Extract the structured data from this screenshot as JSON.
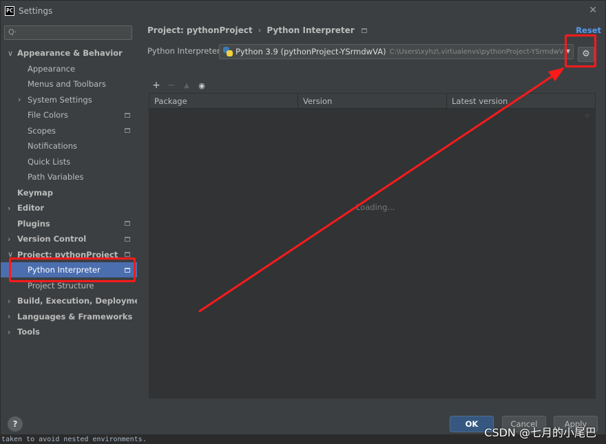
{
  "window": {
    "title": "Settings",
    "close_glyph": "✕",
    "logo_text": "PC"
  },
  "sidebar": {
    "search_placeholder": "",
    "items": [
      {
        "label": "Appearance & Behavior",
        "expanded": true,
        "bold": true
      },
      {
        "label": "Appearance"
      },
      {
        "label": "Menus and Toolbars"
      },
      {
        "label": "System Settings",
        "collapsed": true
      },
      {
        "label": "File Colors"
      },
      {
        "label": "Scopes"
      },
      {
        "label": "Notifications"
      },
      {
        "label": "Quick Lists"
      },
      {
        "label": "Path Variables"
      },
      {
        "label": "Keymap",
        "bold": true
      },
      {
        "label": "Editor",
        "bold": true,
        "collapsed": true
      },
      {
        "label": "Plugins",
        "bold": true
      },
      {
        "label": "Version Control",
        "bold": true,
        "collapsed": true
      },
      {
        "label": "Project: pythonProject",
        "bold": true,
        "expanded": true
      },
      {
        "label": "Python Interpreter",
        "selected": true
      },
      {
        "label": "Project Structure"
      },
      {
        "label": "Build, Execution, Deployment",
        "bold": true,
        "collapsed": true
      },
      {
        "label": "Languages & Frameworks",
        "bold": true,
        "collapsed": true
      },
      {
        "label": "Tools",
        "bold": true,
        "collapsed": true
      }
    ]
  },
  "main": {
    "breadcrumb": {
      "project": "Project: pythonProject",
      "separator": "›",
      "page": "Python Interpreter"
    },
    "reset_label": "Reset",
    "interpreter": {
      "label": "Python Interpreter:",
      "name": "Python 3.9 (pythonProject-YSrmdwVA)",
      "path": "C:\\Users\\xyhz\\.virtualenvs\\pythonProject-YSrmdwVA\\Scripts\\python.exe"
    },
    "toolbar": {
      "add": "+",
      "remove": "−",
      "upgrade": "▲",
      "show": "◉"
    },
    "table": {
      "columns": [
        "Package",
        "Version",
        "Latest version"
      ],
      "rows": []
    },
    "loading_text": "Loading..."
  },
  "footer": {
    "help": "?",
    "ok": "OK",
    "cancel": "Cancel",
    "apply": "Apply"
  },
  "console_text": "taken to avoid nested environments.",
  "watermark": "CSDN @七月的小尾巴",
  "colors": {
    "accent": "#4b6eaf",
    "annotation": "#ff1a1a",
    "link": "#589df6"
  }
}
